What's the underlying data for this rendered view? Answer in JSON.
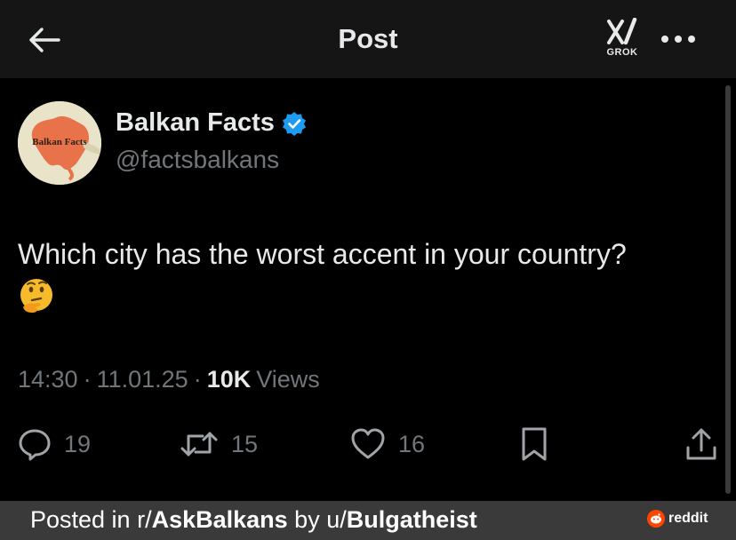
{
  "header": {
    "title": "Post",
    "back_icon": "arrow-left-icon",
    "grok_label": "GROK",
    "more_icon": "more-horizontal-icon"
  },
  "author": {
    "name": "Balkan Facts",
    "handle": "@factsbalkans",
    "avatar_text": "Balkan Facts",
    "verified_icon": "verified-badge-icon",
    "verified_color": "#1d9bf0"
  },
  "post": {
    "text": "Which city has the worst accent in your country?",
    "emoji": "thinking-face-emoji"
  },
  "meta": {
    "time": "14:30",
    "sep1": "·",
    "date": "11.01.25",
    "sep2": "·",
    "views_count": "10K",
    "views_label": "Views"
  },
  "actions": {
    "replies": "19",
    "reposts": "15",
    "likes": "16"
  },
  "footer": {
    "prefix": "Posted in r/",
    "subreddit": "AskBalkans",
    "middle": " by u/",
    "user": "Bulgatheist",
    "brand": "reddit"
  },
  "colors": {
    "background": "#000000",
    "topbar": "#151515",
    "text": "#e7e9ea",
    "muted": "#71767b",
    "footer": "#3a3a3a",
    "reddit_orange": "#ff4500"
  }
}
